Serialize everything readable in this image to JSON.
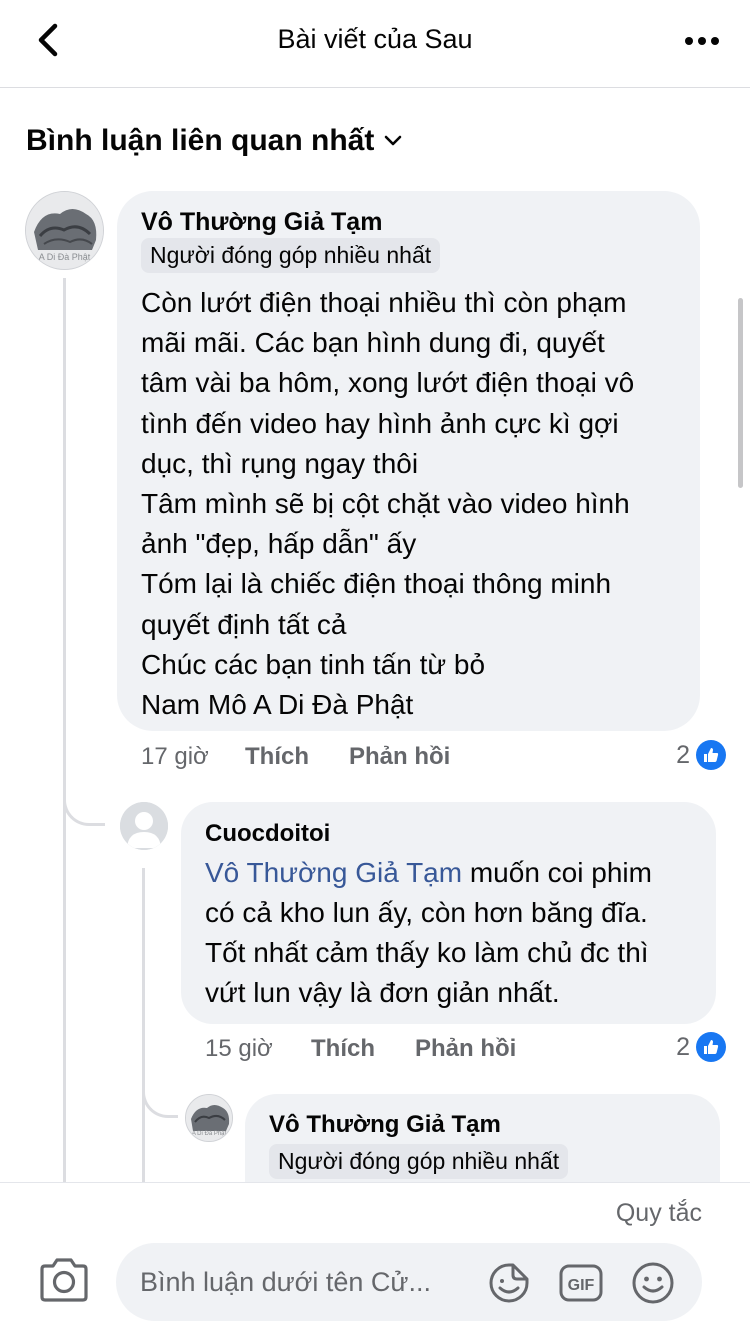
{
  "header": {
    "title": "Bài viết của Sau"
  },
  "sort": {
    "label": "Bình luận liên quan nhất"
  },
  "comments": [
    {
      "author": "Vô Thường Giả Tạm",
      "avatar_text": "A Di Đà Phật",
      "badge": "Người đóng góp nhiều nhất",
      "text": "Còn lướt điện thoại nhiều thì còn phạm\nmãi mãi. Các bạn hình dung đi, quyết\ntâm vài ba hôm, xong lướt điện thoại vô\ntình đến video hay hình ảnh cực kì gợi\ndục, thì rụng ngay thôi\nTâm mình sẽ bị cột chặt vào video hình\nảnh \"đẹp, hấp dẫn\" ấy\nTóm lại là chiếc điện thoại thông minh\nquyết định tất cả\nChúc các bạn tinh tấn từ bỏ\nNam Mô A Di Đà Phật",
      "time": "17 giờ",
      "like_label": "Thích",
      "reply_label": "Phản hồi",
      "reactions": "2"
    },
    {
      "author": "Cuocdoitoi",
      "mention": "Vô Thường Giả Tạm",
      "text_line1": " muốn coi phim",
      "text": "có cả kho lun ấy, còn hơn băng đĩa.\nTốt nhất cảm thấy ko làm chủ đc thì\nvứt lun vậy là đơn giản nhất.",
      "time": "15 giờ",
      "like_label": "Thích",
      "reply_label": "Phản hồi",
      "reactions": "2"
    },
    {
      "author": "Vô Thường Giả Tạm",
      "avatar_text": "A Di Đà Phật",
      "badge": "Người đóng góp nhiều nhất"
    }
  ],
  "composer": {
    "rules_label": "Quy tắc",
    "placeholder": "Bình luận dưới tên Cử..."
  },
  "colors": {
    "accent": "#1877f2",
    "mention": "#385898",
    "bubble": "#f0f2f5",
    "secondary_text": "#65676b"
  }
}
